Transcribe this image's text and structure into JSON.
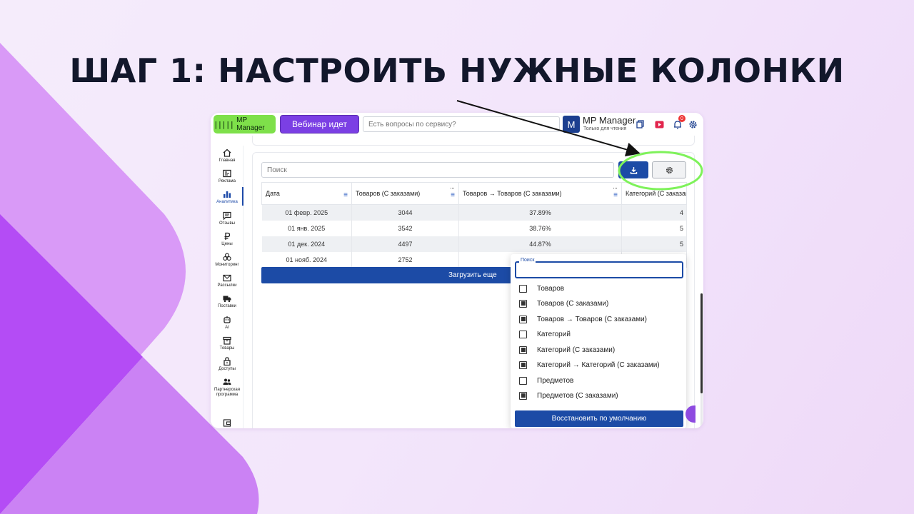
{
  "slide": {
    "title": "ШАГ 1: НАСТРОИТЬ НУЖНЫЕ КОЛОНКИ",
    "accent_purple": "#b44cf5",
    "highlight_green": "#7ef25a"
  },
  "topbar": {
    "logo_label": "MP Manager",
    "webinar_label": "Вебинар идет",
    "question_placeholder": "Есть вопросы по сервису?",
    "avatar_letter": "M",
    "account_name": "MP Manager",
    "account_role": "Только для чтения",
    "notification_count": "0"
  },
  "sidebar": {
    "items": [
      {
        "label": "Главная",
        "icon": "home-icon"
      },
      {
        "label": "Реклама",
        "icon": "ads-icon"
      },
      {
        "label": "Аналитика",
        "icon": "analytics-icon",
        "active": true
      },
      {
        "label": "Отзывы",
        "icon": "reviews-icon"
      },
      {
        "label": "Цены",
        "icon": "ruble-icon"
      },
      {
        "label": "Мониторинг",
        "icon": "monitoring-icon"
      },
      {
        "label": "Рассылки",
        "icon": "mail-icon"
      },
      {
        "label": "Поставки",
        "icon": "truck-icon"
      },
      {
        "label": "AI",
        "icon": "robot-icon"
      },
      {
        "label": "Товары",
        "icon": "box-icon"
      },
      {
        "label": "Доступы",
        "icon": "lock-icon"
      },
      {
        "label": "Партнерская программа",
        "icon": "partners-icon"
      }
    ]
  },
  "main": {
    "search_placeholder": "Поиск",
    "load_more_label": "Загрузить еще",
    "table": {
      "columns": [
        "Дата",
        "Товаров (С заказами)",
        "Товаров → Товаров (С заказами)",
        "Категорий (С заказами)"
      ],
      "rows": [
        [
          "01 февр. 2025",
          "3044",
          "37.89%",
          "4"
        ],
        [
          "01 янв. 2025",
          "3542",
          "38.76%",
          "5"
        ],
        [
          "01 дек. 2024",
          "4497",
          "44.87%",
          "5"
        ],
        [
          "01 нояб. 2024",
          "2752",
          "",
          ""
        ]
      ]
    }
  },
  "column_picker": {
    "search_label": "Поиск",
    "search_value": "",
    "options": [
      {
        "label": "Товаров",
        "checked": false
      },
      {
        "label": "Товаров (С заказами)",
        "checked": true
      },
      {
        "label": "Товаров → Товаров (С заказами)",
        "checked": true
      },
      {
        "label": "Категорий",
        "checked": false
      },
      {
        "label": "Категорий (С заказами)",
        "checked": true
      },
      {
        "label": "Категорий → Категорий (С заказами)",
        "checked": true
      },
      {
        "label": "Предметов",
        "checked": false
      },
      {
        "label": "Предметов (С заказами)",
        "checked": true
      }
    ],
    "restore_label": "Восстановить по умолчанию"
  }
}
